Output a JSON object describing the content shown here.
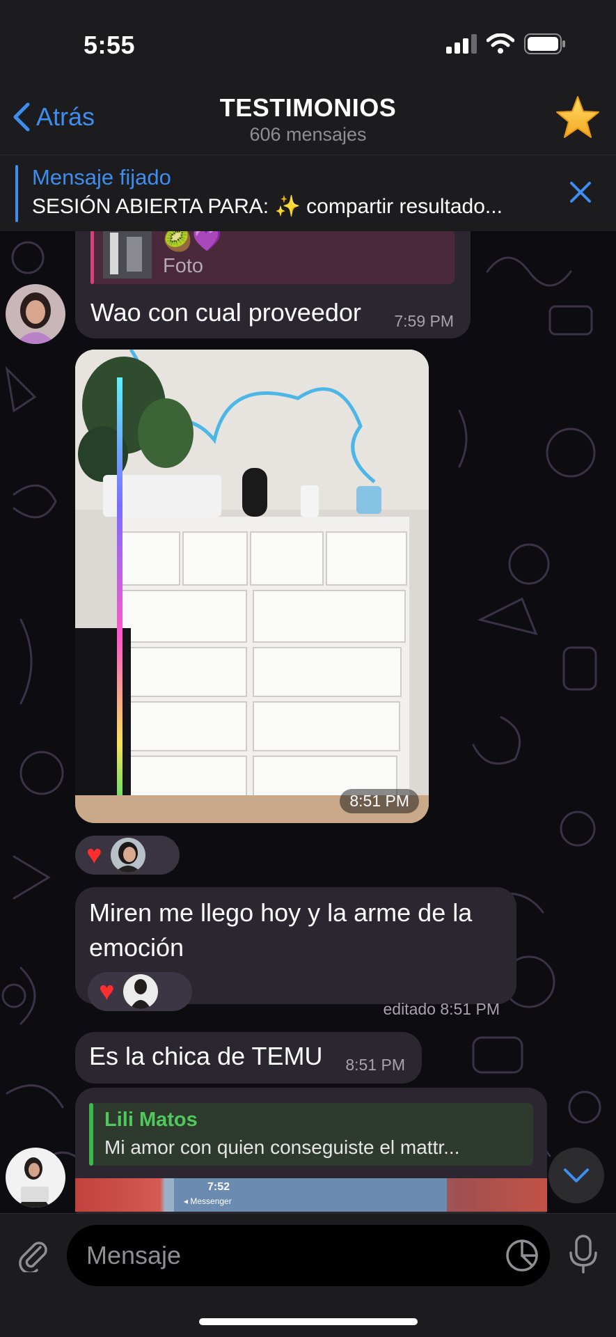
{
  "status_bar": {
    "time": "5:55"
  },
  "header": {
    "back_label": "Atrás",
    "title": "TESTIMONIOS",
    "subtitle": "606 mensajes",
    "avatar_icon": "star-icon"
  },
  "pinned": {
    "label": "Mensaje fijado",
    "text": "SESIÓN ABIERTA PARA: ✨ compartir resultado..."
  },
  "messages": [
    {
      "reply_label": "Foto",
      "reply_emoji": "🥝💜",
      "text": "Wao con cual proveedor",
      "time": "7:59 PM"
    },
    {
      "type": "photo",
      "time": "8:51 PM"
    },
    {
      "text": "Miren me llego hoy y la arme de la emoción",
      "time": "editado 8:51 PM"
    },
    {
      "text": "Es la chica de TEMU",
      "time": "8:51 PM"
    },
    {
      "reply_name": "Lili Matos",
      "reply_text": "Mi amor con quien conseguiste el mattr...",
      "preview_time": "7:52",
      "preview_app": "◂ Messenger"
    }
  ],
  "input": {
    "placeholder": "Mensaje"
  },
  "colors": {
    "accent": "#3d8ef0",
    "bubble": "#2c2630",
    "reply_green": "#3fb84b",
    "reply_pink": "#d6417b"
  }
}
